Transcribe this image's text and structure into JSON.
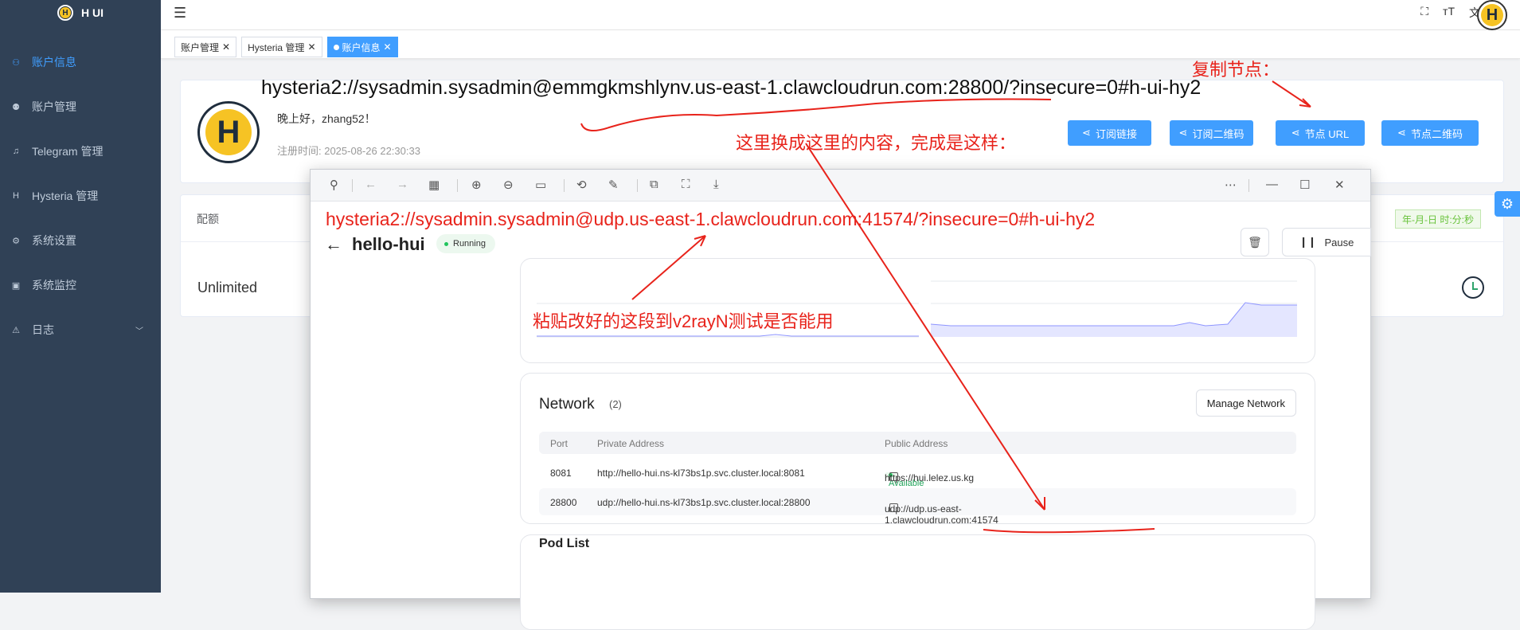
{
  "sidebar": {
    "brand": "H UI",
    "logo_letter": "H",
    "items": [
      {
        "label": "账户信息",
        "icon": "user-icon",
        "glyph": "⚇"
      },
      {
        "label": "账户管理",
        "icon": "users-icon",
        "glyph": "⚉"
      },
      {
        "label": "Telegram 管理",
        "icon": "bell-icon",
        "glyph": "♫"
      },
      {
        "label": "Hysteria 管理",
        "icon": "h-icon",
        "glyph": "H"
      },
      {
        "label": "系统设置",
        "icon": "gear-icon",
        "glyph": "⚙"
      },
      {
        "label": "系统监控",
        "icon": "monitor-icon",
        "glyph": "▣"
      },
      {
        "label": "日志",
        "icon": "warning-icon",
        "glyph": "⚠"
      }
    ]
  },
  "topbar": {
    "avatar_letter": "H"
  },
  "tags": [
    {
      "label": "账户管理"
    },
    {
      "label": "Hysteria 管理"
    },
    {
      "label": "账户信息"
    }
  ],
  "user_card": {
    "avatar_letter": "H",
    "greeting": "晚上好，zhang52！",
    "register_time": "注册时间: 2025-08-26 22:30:33",
    "buttons": [
      "订阅链接",
      "订阅二维码",
      "节点 URL",
      "节点二维码"
    ]
  },
  "quota_card": {
    "label": "配额",
    "value": "Unlimited",
    "date_format": "年-月-日 时:分:秒"
  },
  "window": {
    "app_name": "hello-hui",
    "status": "Running",
    "pause_label": "Pause",
    "network": {
      "title": "Network",
      "count": "(2)",
      "manage_label": "Manage Network",
      "headers": [
        "Port",
        "Private Address",
        "Public Address"
      ],
      "rows": [
        {
          "port": "8081",
          "private": "http://hello-hui.ns-kl73bs1p.svc.cluster.local:8081",
          "available": "Available",
          "public": "https://hui.lelez.us.kg"
        },
        {
          "port": "28800",
          "private": "udp://hello-hui.ns-kl73bs1p.svc.cluster.local:28800",
          "available": "",
          "public": "udp://udp.us-east-1.clawcloudrun.com:41574"
        }
      ]
    },
    "section3_partial": "Pod List"
  },
  "annotations": {
    "copy_node": "复制节点：",
    "replace_hint": "这里换成这里的内容，完成是这样：",
    "paste_hint": "粘贴改好的这段到v2rayN测试是否能用",
    "original_url": "hysteria2://sysadmin.sysadmin@emmgkmshlynv.us-east-1.clawcloudrun.com:28800/?insecure=0#h-ui-hy2",
    "modified_url": "hysteria2://sysadmin.sysadmin@udp.us-east-1.clawcloudrun.com:41574/?insecure=0#h-ui-hy2",
    "color": "#e8231b"
  },
  "colors": {
    "sidebar": "#304156",
    "primary": "#409eff",
    "accent_yellow": "#f6c324"
  }
}
